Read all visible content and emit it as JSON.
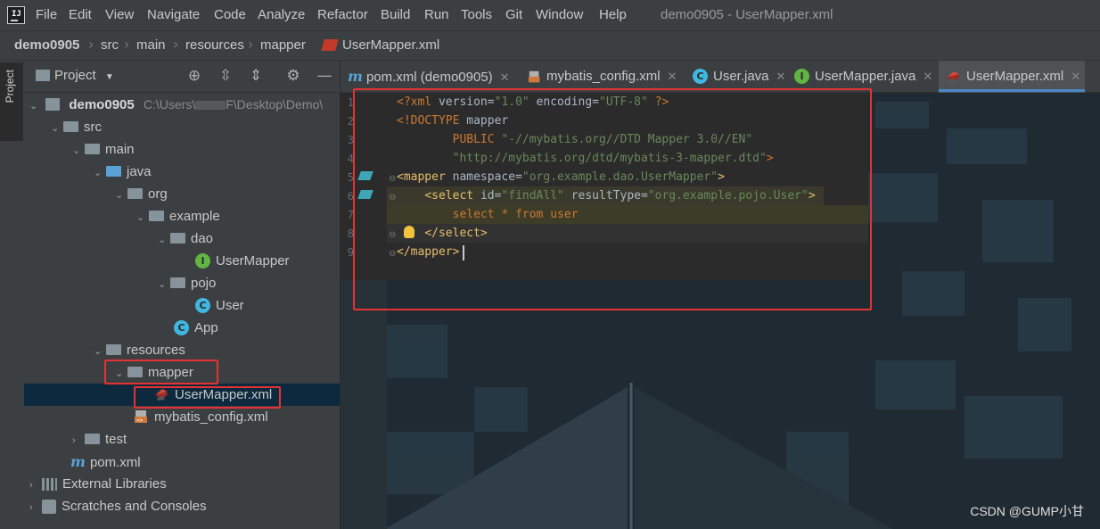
{
  "menu": {
    "items": [
      "File",
      "Edit",
      "View",
      "Navigate",
      "Code",
      "Analyze",
      "Refactor",
      "Build",
      "Run",
      "Tools",
      "Git",
      "Window",
      "Help"
    ],
    "window_title": "demo0905 - UserMapper.xml"
  },
  "breadcrumb": [
    "demo0905",
    "src",
    "main",
    "resources",
    "mapper",
    "UserMapper.xml"
  ],
  "sidebar": {
    "stripe_label": "Project"
  },
  "project": {
    "view_label": "Project",
    "view_chevron": "▼",
    "tree": [
      {
        "label": "demo0905",
        "path": "C:\\Users\\",
        "path_tail": "F\\Desktop\\Demo\\"
      },
      {
        "label": "src"
      },
      {
        "label": "main"
      },
      {
        "label": "java"
      },
      {
        "label": "org"
      },
      {
        "label": "example"
      },
      {
        "label": "dao"
      },
      {
        "label": "UserMapper"
      },
      {
        "label": "pojo"
      },
      {
        "label": "User"
      },
      {
        "label": "App"
      },
      {
        "label": "resources"
      },
      {
        "label": "mapper"
      },
      {
        "label": "UserMapper.xml"
      },
      {
        "label": "mybatis_config.xml"
      },
      {
        "label": "test"
      },
      {
        "label": "pom.xml"
      },
      {
        "label": "External Libraries"
      },
      {
        "label": "Scratches and Consoles"
      }
    ]
  },
  "editor": {
    "tabs": [
      {
        "label": "pom.xml (demo0905)"
      },
      {
        "label": "mybatis_config.xml"
      },
      {
        "label": "User.java"
      },
      {
        "label": "UserMapper.java"
      },
      {
        "label": "UserMapper.xml",
        "active": true
      }
    ],
    "line_numbers": [
      "1",
      "2",
      "3",
      "4",
      "5",
      "6",
      "7",
      "8",
      "9"
    ],
    "lines": [
      [
        {
          "c": "k",
          "t": "<?xml "
        },
        {
          "c": "n",
          "t": "version="
        },
        {
          "c": "v",
          "t": "\"1.0\""
        },
        {
          "c": "n",
          "t": " encoding="
        },
        {
          "c": "v",
          "t": "\"UTF-8\""
        },
        {
          "c": "k",
          "t": " ?>"
        }
      ],
      [
        {
          "c": "k",
          "t": "<!DOCTYPE "
        },
        {
          "c": "n",
          "t": "mapper"
        }
      ],
      [
        {
          "c": "n",
          "t": "        "
        },
        {
          "c": "k",
          "t": "PUBLIC "
        },
        {
          "c": "v",
          "t": "\"-//mybatis.org//DTD Mapper 3.0//EN\""
        }
      ],
      [
        {
          "c": "n",
          "t": "        "
        },
        {
          "c": "v",
          "t": "\"http://mybatis.org/dtd/mybatis-3-mapper.dtd\""
        },
        {
          "c": "k",
          "t": ">"
        }
      ],
      [
        {
          "c": "t",
          "t": "<mapper "
        },
        {
          "c": "n",
          "t": "namespace="
        },
        {
          "c": "v",
          "t": "\"org.example.dao.UserMapper\""
        },
        {
          "c": "t",
          "t": ">"
        }
      ],
      [
        {
          "c": "n",
          "t": "    "
        },
        {
          "c": "t",
          "t": "<select "
        },
        {
          "c": "n",
          "t": "id="
        },
        {
          "c": "v",
          "t": "\"findAll\""
        },
        {
          "c": "n",
          "t": " resultType="
        },
        {
          "c": "v",
          "t": "\"org.example.pojo.User\""
        },
        {
          "c": "t",
          "t": ">"
        }
      ],
      [
        {
          "c": "n",
          "t": "        "
        },
        {
          "c": "k",
          "t": "select * from user"
        }
      ],
      [
        {
          "c": "n",
          "t": "    "
        },
        {
          "c": "t",
          "t": "</select>"
        }
      ],
      [
        {
          "c": "t",
          "t": "</mapper>"
        }
      ]
    ]
  },
  "watermark": "CSDN @GUMP小甘",
  "colors": {
    "highlight_box": "#e53232",
    "selection": "#0d293e",
    "accent": "#4a88c7"
  }
}
